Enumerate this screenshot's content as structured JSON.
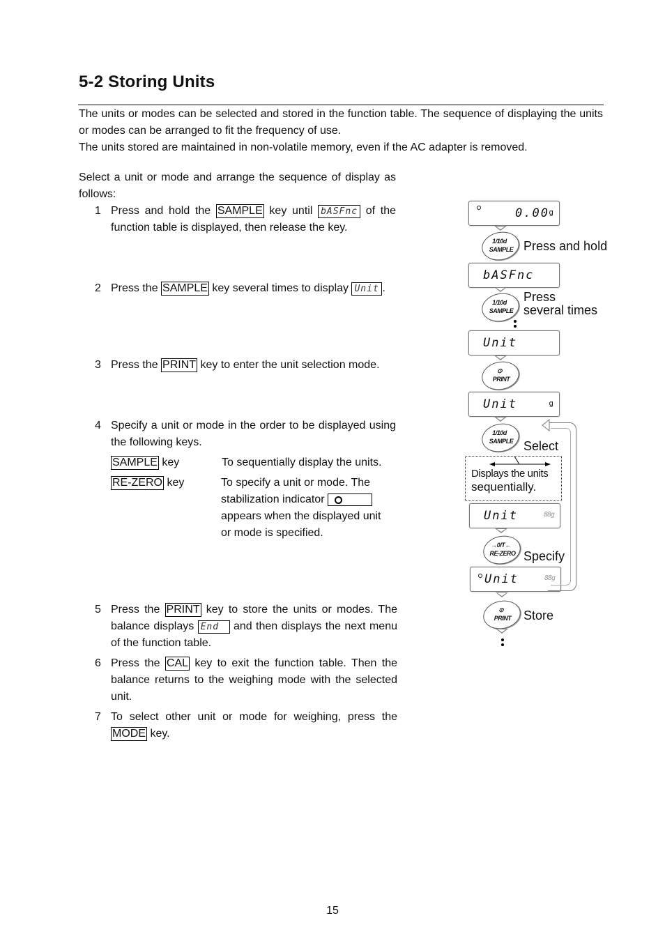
{
  "section": {
    "number": "5-2",
    "title": "5-2  Storing Units"
  },
  "intro": {
    "para1": "The units or modes can be selected and stored in the function table. The sequence of displaying the units or modes can be arranged to fit the frequency of use.",
    "para2": "The units stored are maintained in non-volatile memory, even if the AC adapter is removed.",
    "lead": "Select a unit or mode and arrange the sequence of display as follows:"
  },
  "steps": [
    {
      "n": "1",
      "a": "Press and hold the ",
      "key": "SAMPLE",
      "b": " key until ",
      "lcd": "bASFnc",
      "c": " of the function table is displayed, then release the key."
    },
    {
      "n": "2",
      "a": "Press the ",
      "key": "SAMPLE",
      "b": " key several times to display ",
      "lcd": "Unit",
      "c": "."
    },
    {
      "n": "3",
      "a": "Press the ",
      "key": "PRINT",
      "b": " key to enter the unit selection mode."
    },
    {
      "n": "4",
      "a": "Specify a unit or mode in the order to be displayed using the following keys."
    },
    {
      "n": "5",
      "a": "Press the ",
      "key": "PRINT",
      "b": " key to store the units or modes. The balance displays ",
      "lcd": "End",
      "c": " and then displays the next menu of the function table."
    },
    {
      "n": "6",
      "a": "Press the ",
      "key": "CAL",
      "b": " key to exit the function table. Then the balance returns to the weighing mode with the selected unit."
    },
    {
      "n": "7",
      "a": "To select other unit or mode for weighing, press the ",
      "key": "MODE",
      "b": " key."
    }
  ],
  "keys_table": [
    {
      "key": "SAMPLE",
      "suffix": " key",
      "desc": "To sequentially display the units."
    },
    {
      "key": "RE-ZERO",
      "suffix": " key",
      "desc1": "To specify a unit or mode. The stabilization indicator",
      "desc2": "appears when the displayed unit or mode is specified."
    }
  ],
  "diagram": {
    "displays": [
      {
        "text": "0.00",
        "unit": "g",
        "stable": true
      },
      {
        "text": "bASFnc"
      },
      {
        "text": "Unit"
      },
      {
        "text": "Unit",
        "unit": "g"
      },
      {
        "text": "Unit",
        "ghost": "88g"
      },
      {
        "text": "Unit",
        "ghost": "88g",
        "stable": true
      }
    ],
    "buttons": [
      {
        "line1": "1/10d",
        "line2": "SAMPLE",
        "label": "Press and hold"
      },
      {
        "line1": "1/10d",
        "line2": "SAMPLE",
        "label1": "Press",
        "label2": "several times"
      },
      {
        "line1": "⊙",
        "line2": "PRINT"
      },
      {
        "line1": "1/10d",
        "line2": "SAMPLE",
        "label": "Select"
      },
      {
        "line1": "→0/T←",
        "line2": "RE-ZERO",
        "label": "Specify"
      },
      {
        "line1": "⊙",
        "line2": "PRINT",
        "label": "Store"
      }
    ],
    "note": {
      "line1": "Displays the units",
      "line2": "sequentially."
    }
  },
  "page_number": "15"
}
